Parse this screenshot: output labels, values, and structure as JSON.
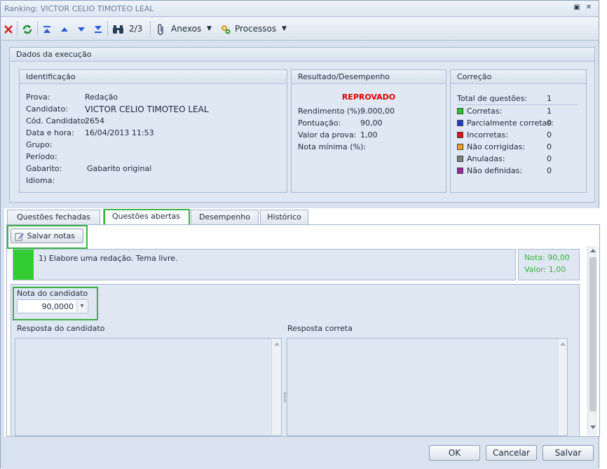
{
  "window": {
    "title": "Ranking: VICTOR CELIO TIMOTEO LEAL"
  },
  "toolbar": {
    "page_indicator": "2/3",
    "attachments_label": "Anexos",
    "processes_label": "Processos"
  },
  "execution": {
    "title": "Dados da execução",
    "identification": {
      "title": "Identificação",
      "rows": [
        {
          "label": "Prova:",
          "value": "Redação"
        },
        {
          "label": "Candidato:",
          "value": "VICTOR CELIO TIMOTEO LEAL"
        },
        {
          "label": "Cód. Candidato:",
          "value": "2654"
        },
        {
          "label": "Data e hora:",
          "value": "16/04/2013 11:53"
        },
        {
          "label": "Grupo:",
          "value": ""
        },
        {
          "label": "Período:",
          "value": ""
        },
        {
          "label": "Gabarito:",
          "value": "Gabarito original"
        },
        {
          "label": "Idioma:",
          "value": ""
        }
      ]
    },
    "result": {
      "title": "Resultado/Desempenho",
      "status": "REPROVADO",
      "status_color": "#e00000",
      "rows": [
        {
          "label": "Rendimento (%):",
          "value": "9.000,00"
        },
        {
          "label": "Pontuação:",
          "value": "90,00"
        },
        {
          "label": "Valor da prova:",
          "value": "1,00"
        },
        {
          "label": "Nota mínima (%):",
          "value": ""
        }
      ]
    },
    "correction": {
      "title": "Correção",
      "total_label": "Total de questões:",
      "total_value": "1",
      "items": [
        {
          "label": "Corretas:",
          "value": "1",
          "color": "#22cc22"
        },
        {
          "label": "Parcialmente corretas:",
          "value": "0",
          "color": "#1a3fd0"
        },
        {
          "label": "Incorretas:",
          "value": "0",
          "color": "#e01010"
        },
        {
          "label": "Não corrigidas:",
          "value": "0",
          "color": "#f0a020"
        },
        {
          "label": "Anuladas:",
          "value": "0",
          "color": "#7f7f7f"
        },
        {
          "label": "Não definidas:",
          "value": "0",
          "color": "#a020a0"
        }
      ]
    }
  },
  "tabs": [
    {
      "label": "Questões fechadas"
    },
    {
      "label": "Questões abertas"
    },
    {
      "label": "Desempenho"
    },
    {
      "label": "Histórico"
    }
  ],
  "open_questions": {
    "save_grades_label": "Salvar notas",
    "question_text": "1) Elabore uma redação. Tema livre.",
    "question_color": "#33cc33",
    "score_label": "Nota: 90,00",
    "value_label": "Valor: 1,00",
    "grade_label": "Nota do candidato",
    "grade_value": "90,0000",
    "candidate_answer_label": "Resposta do candidato",
    "correct_answer_label": "Resposta correta"
  },
  "footer": {
    "ok_label": "OK",
    "cancel_label": "Cancelar",
    "save_label": "Salvar"
  }
}
